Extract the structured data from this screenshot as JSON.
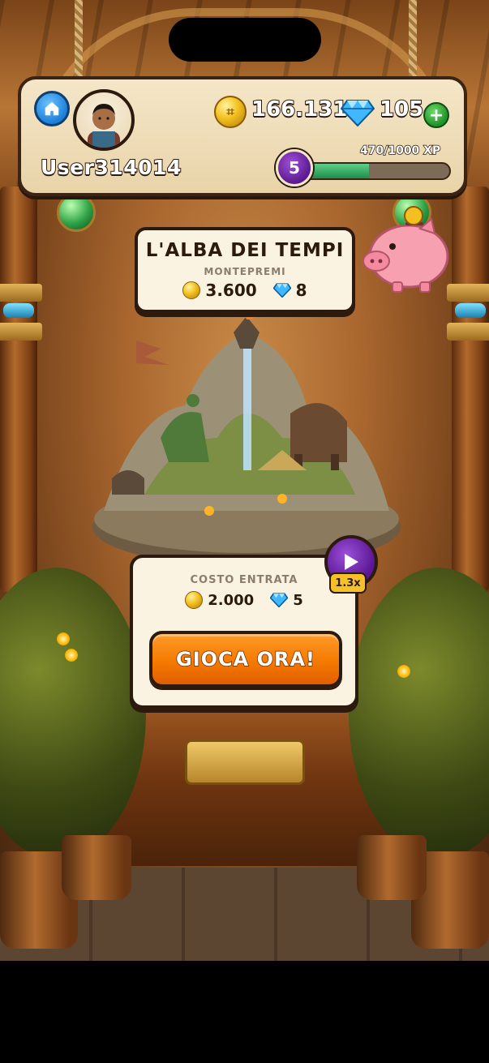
{
  "header": {
    "username": "User314014",
    "coins": "166.131",
    "gems": "105",
    "level": "5",
    "xp_text": "470/1000 XP",
    "xp_fraction": 0.47
  },
  "event": {
    "title": "L'ALBA DEI TEMPI",
    "prize_label": "MONTEPREMI",
    "prize_coins": "3.600",
    "prize_gems": "8"
  },
  "entry": {
    "label": "COSTO ENTRATA",
    "cost_coins": "2.000",
    "cost_gems": "5",
    "play_label": "GIOCA ORA!",
    "multiplier": "1.3x"
  },
  "colors": {
    "accent_orange": "#f57a00",
    "level_purple": "#5b1a8f",
    "xp_green": "#1e8d4b",
    "card_bg": "#fbf3e2"
  },
  "icons": [
    "home-icon",
    "coin-icon",
    "diamond-icon",
    "plus-icon",
    "piggy-bank-icon",
    "play-icon"
  ]
}
